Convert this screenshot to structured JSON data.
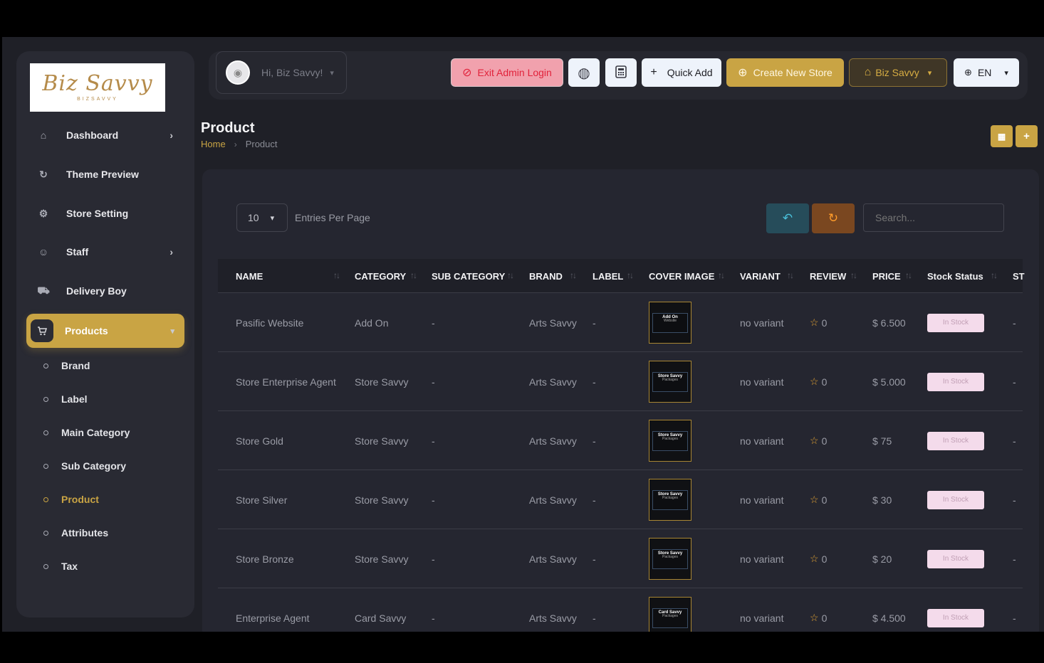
{
  "brand": {
    "logo_text": "Biz Savvy",
    "logo_sub": "BIZSAVVY"
  },
  "sidebar": {
    "items": [
      {
        "label": "Dashboard",
        "icon": "home-icon",
        "chevron": true
      },
      {
        "label": "Theme Preview",
        "icon": "refresh-icon",
        "chevron": false
      },
      {
        "label": "Store Setting",
        "icon": "settings-icon",
        "chevron": false
      },
      {
        "label": "Staff",
        "icon": "users-icon",
        "chevron": true
      },
      {
        "label": "Delivery Boy",
        "icon": "truck-icon",
        "chevron": false
      },
      {
        "label": "Products",
        "icon": "cart-icon",
        "chevron": true,
        "active": true
      }
    ],
    "subitems": [
      "Brand",
      "Label",
      "Main Category",
      "Sub Category",
      "Product",
      "Attributes",
      "Tax"
    ],
    "active_subitem": "Product"
  },
  "topbar": {
    "greeting": "Hi, Biz Savvy!",
    "exit_admin": "Exit Admin Login",
    "quick_add": "Quick Add",
    "create_store": "Create New Store",
    "store_name": "Biz Savvy",
    "language": "EN"
  },
  "page": {
    "title": "Product",
    "breadcrumb_home": "Home",
    "breadcrumb_current": "Product"
  },
  "controls": {
    "entries_value": "10",
    "entries_label": "Entries Per Page",
    "search_placeholder": "Search..."
  },
  "table": {
    "headers": [
      "NAME",
      "CATEGORY",
      "SUB CATEGORY",
      "BRAND",
      "LABEL",
      "COVER IMAGE",
      "VARIANT",
      "REVIEW",
      "PRICE",
      "Stock Status",
      "ST"
    ],
    "rows": [
      {
        "name": "Pasific Website",
        "category": "Add On",
        "sub_category": "-",
        "brand": "Arts Savvy",
        "label": "-",
        "cover": "Add On",
        "cover_sub": "Website",
        "variant": "no variant",
        "review": "0",
        "price": "$ 6.500",
        "stock": "In Stock",
        "extra": "-"
      },
      {
        "name": "Store Enterprise Agent",
        "category": "Store Savvy",
        "sub_category": "-",
        "brand": "Arts Savvy",
        "label": "-",
        "cover": "Store Savvy",
        "cover_sub": "Packages",
        "variant": "no variant",
        "review": "0",
        "price": "$ 5.000",
        "stock": "In Stock",
        "extra": "-"
      },
      {
        "name": "Store Gold",
        "category": "Store Savvy",
        "sub_category": "-",
        "brand": "Arts Savvy",
        "label": "-",
        "cover": "Store Savvy",
        "cover_sub": "Packages",
        "variant": "no variant",
        "review": "0",
        "price": "$ 75",
        "stock": "In Stock",
        "extra": "-"
      },
      {
        "name": "Store Silver",
        "category": "Store Savvy",
        "sub_category": "-",
        "brand": "Arts Savvy",
        "label": "-",
        "cover": "Store Savvy",
        "cover_sub": "Packages",
        "variant": "no variant",
        "review": "0",
        "price": "$ 30",
        "stock": "In Stock",
        "extra": "-"
      },
      {
        "name": "Store Bronze",
        "category": "Store Savvy",
        "sub_category": "-",
        "brand": "Arts Savvy",
        "label": "-",
        "cover": "Store Savvy",
        "cover_sub": "Packages",
        "variant": "no variant",
        "review": "0",
        "price": "$ 20",
        "stock": "In Stock",
        "extra": "-"
      },
      {
        "name": "Enterprise Agent",
        "category": "Card Savvy",
        "sub_category": "-",
        "brand": "Arts Savvy",
        "label": "-",
        "cover": "Card Savvy",
        "cover_sub": "Packages",
        "variant": "no variant",
        "review": "0",
        "price": "$ 4.500",
        "stock": "In Stock",
        "extra": "-"
      }
    ]
  },
  "colors": {
    "accent": "#c9a444",
    "background": "#1f2027",
    "panel": "#292a33",
    "danger": "#e1223b",
    "badge": "#f4dbeb"
  }
}
